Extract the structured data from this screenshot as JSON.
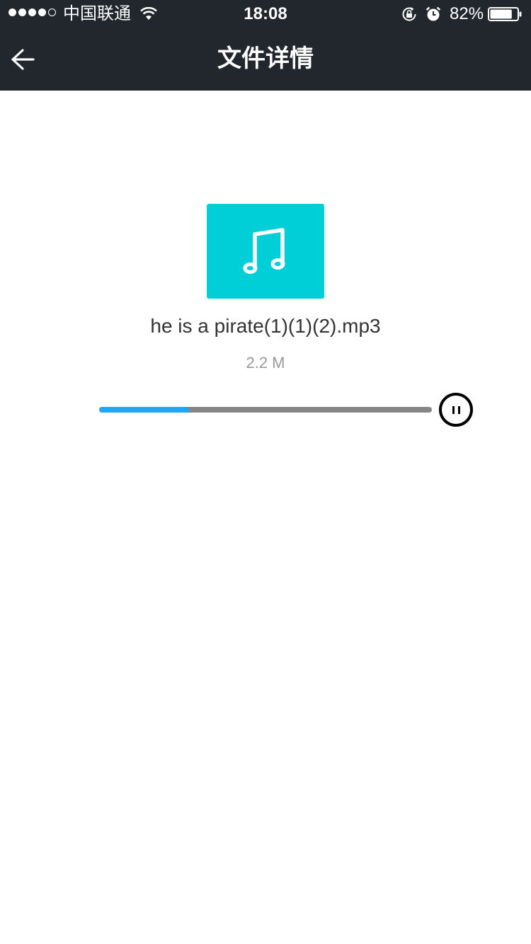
{
  "status_bar": {
    "signal_full_dots": 4,
    "signal_total_dots": 5,
    "carrier": "中国联通",
    "time": "18:08",
    "battery_percent": "82%",
    "battery_level": 0.82,
    "icons": [
      "wifi-icon",
      "rotation-lock-icon",
      "alarm-icon",
      "battery-icon"
    ]
  },
  "navbar": {
    "back_icon": "back-arrow-icon",
    "title": "文件详情"
  },
  "file": {
    "icon": "music-note-icon",
    "icon_color": "#00cfd8",
    "name": "he is a pirate(1)(1)(2).mp3",
    "size": "2.2 M"
  },
  "player": {
    "progress": 0.27,
    "progress_color": "#1ea7f8",
    "track_color": "#858585",
    "state_icon": "pause-icon"
  }
}
